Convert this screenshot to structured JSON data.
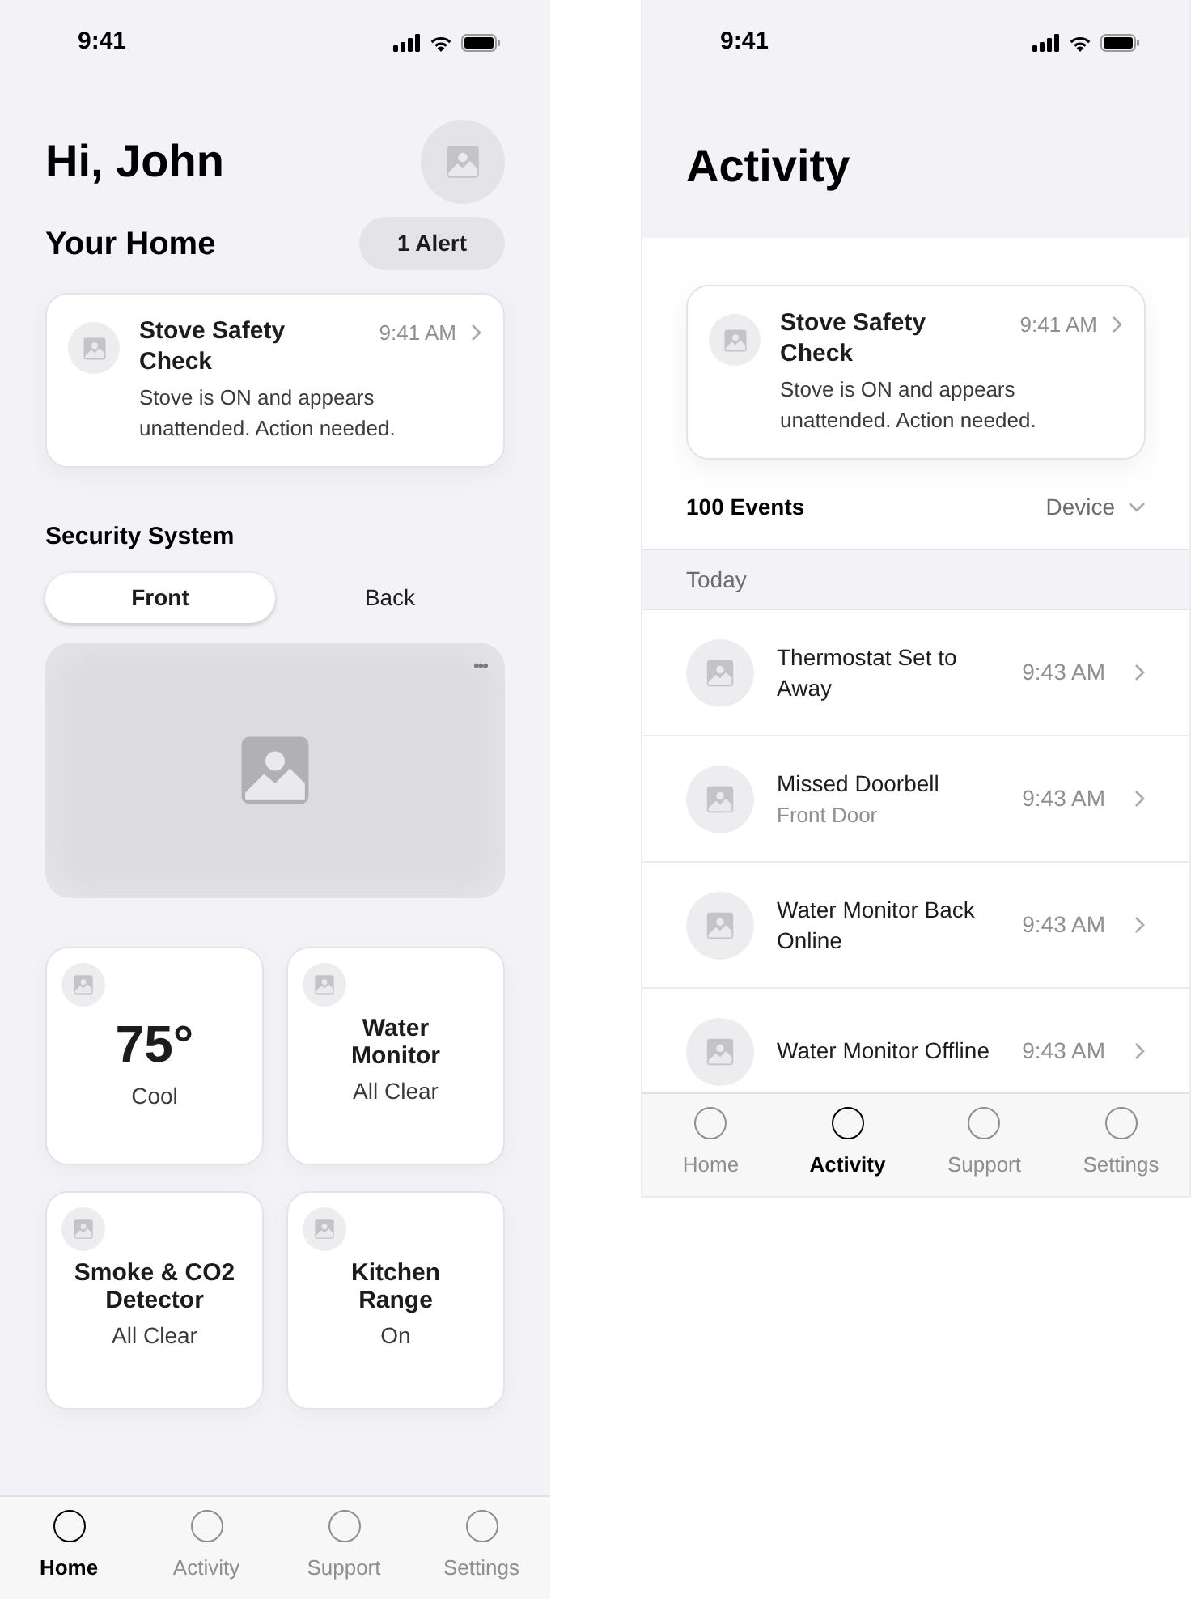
{
  "home_screen": {
    "status_time": "9:41",
    "greeting": "Hi, John",
    "section_title": "Your Home",
    "alert_button": "1 Alert",
    "alert_card": {
      "title": "Stove Safety\nCheck",
      "time": "9:41 AM",
      "message": "Stove is ON and appears unattended. Action needed."
    },
    "security": {
      "title": "Security System",
      "tabs": [
        {
          "label": "Front",
          "selected": true
        },
        {
          "label": "Back",
          "selected": false
        }
      ],
      "more": "•••"
    },
    "tiles": [
      {
        "kind": "temperature",
        "value": "75°",
        "status": "Cool"
      },
      {
        "kind": "device",
        "name": "Water\nMonitor",
        "status": "All Clear"
      },
      {
        "kind": "device",
        "name": "Smoke & CO2\nDetector",
        "status": "All Clear"
      },
      {
        "kind": "device",
        "name": "Kitchen\nRange",
        "status": "On"
      }
    ],
    "tab_bar": [
      {
        "label": "Home",
        "selected": true
      },
      {
        "label": "Activity",
        "selected": false
      },
      {
        "label": "Support",
        "selected": false
      },
      {
        "label": "Settings",
        "selected": false
      }
    ]
  },
  "activity_screen": {
    "status_time": "9:41",
    "title": "Activity",
    "alert_card": {
      "title": "Stove Safety\nCheck",
      "time": "9:41 AM",
      "message": "Stove is ON and appears unattended. Action needed."
    },
    "event_count": "100 Events",
    "filter": "Device",
    "section_header": "Today",
    "events": [
      {
        "title": "Thermostat Set to\nAway",
        "time": "9:43 AM"
      },
      {
        "title": "Missed Doorbell",
        "subtitle": "Front Door",
        "time": "9:43 AM"
      },
      {
        "title": "Water Monitor Back\nOnline",
        "time": "9:43 AM"
      },
      {
        "title": "Water Monitor Offline",
        "time": "9:43 AM"
      }
    ],
    "tab_bar": [
      {
        "label": "Home",
        "selected": false
      },
      {
        "label": "Activity",
        "selected": true
      },
      {
        "label": "Support",
        "selected": false
      },
      {
        "label": "Settings",
        "selected": false
      }
    ]
  }
}
